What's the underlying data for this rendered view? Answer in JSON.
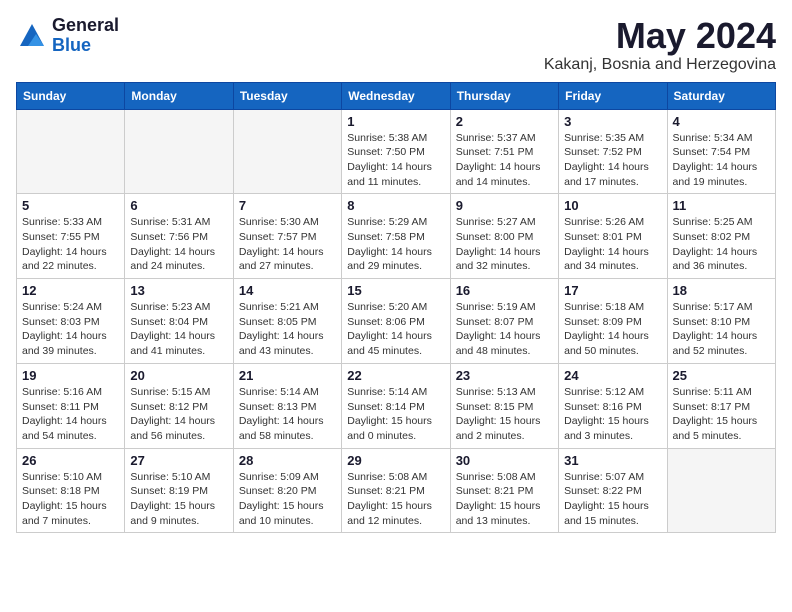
{
  "header": {
    "logo_general": "General",
    "logo_blue": "Blue",
    "month_title": "May 2024",
    "location": "Kakanj, Bosnia and Herzegovina"
  },
  "weekdays": [
    "Sunday",
    "Monday",
    "Tuesday",
    "Wednesday",
    "Thursday",
    "Friday",
    "Saturday"
  ],
  "weeks": [
    [
      {
        "day": "",
        "info": ""
      },
      {
        "day": "",
        "info": ""
      },
      {
        "day": "",
        "info": ""
      },
      {
        "day": "1",
        "info": "Sunrise: 5:38 AM\nSunset: 7:50 PM\nDaylight: 14 hours and 11 minutes."
      },
      {
        "day": "2",
        "info": "Sunrise: 5:37 AM\nSunset: 7:51 PM\nDaylight: 14 hours and 14 minutes."
      },
      {
        "day": "3",
        "info": "Sunrise: 5:35 AM\nSunset: 7:52 PM\nDaylight: 14 hours and 17 minutes."
      },
      {
        "day": "4",
        "info": "Sunrise: 5:34 AM\nSunset: 7:54 PM\nDaylight: 14 hours and 19 minutes."
      }
    ],
    [
      {
        "day": "5",
        "info": "Sunrise: 5:33 AM\nSunset: 7:55 PM\nDaylight: 14 hours and 22 minutes."
      },
      {
        "day": "6",
        "info": "Sunrise: 5:31 AM\nSunset: 7:56 PM\nDaylight: 14 hours and 24 minutes."
      },
      {
        "day": "7",
        "info": "Sunrise: 5:30 AM\nSunset: 7:57 PM\nDaylight: 14 hours and 27 minutes."
      },
      {
        "day": "8",
        "info": "Sunrise: 5:29 AM\nSunset: 7:58 PM\nDaylight: 14 hours and 29 minutes."
      },
      {
        "day": "9",
        "info": "Sunrise: 5:27 AM\nSunset: 8:00 PM\nDaylight: 14 hours and 32 minutes."
      },
      {
        "day": "10",
        "info": "Sunrise: 5:26 AM\nSunset: 8:01 PM\nDaylight: 14 hours and 34 minutes."
      },
      {
        "day": "11",
        "info": "Sunrise: 5:25 AM\nSunset: 8:02 PM\nDaylight: 14 hours and 36 minutes."
      }
    ],
    [
      {
        "day": "12",
        "info": "Sunrise: 5:24 AM\nSunset: 8:03 PM\nDaylight: 14 hours and 39 minutes."
      },
      {
        "day": "13",
        "info": "Sunrise: 5:23 AM\nSunset: 8:04 PM\nDaylight: 14 hours and 41 minutes."
      },
      {
        "day": "14",
        "info": "Sunrise: 5:21 AM\nSunset: 8:05 PM\nDaylight: 14 hours and 43 minutes."
      },
      {
        "day": "15",
        "info": "Sunrise: 5:20 AM\nSunset: 8:06 PM\nDaylight: 14 hours and 45 minutes."
      },
      {
        "day": "16",
        "info": "Sunrise: 5:19 AM\nSunset: 8:07 PM\nDaylight: 14 hours and 48 minutes."
      },
      {
        "day": "17",
        "info": "Sunrise: 5:18 AM\nSunset: 8:09 PM\nDaylight: 14 hours and 50 minutes."
      },
      {
        "day": "18",
        "info": "Sunrise: 5:17 AM\nSunset: 8:10 PM\nDaylight: 14 hours and 52 minutes."
      }
    ],
    [
      {
        "day": "19",
        "info": "Sunrise: 5:16 AM\nSunset: 8:11 PM\nDaylight: 14 hours and 54 minutes."
      },
      {
        "day": "20",
        "info": "Sunrise: 5:15 AM\nSunset: 8:12 PM\nDaylight: 14 hours and 56 minutes."
      },
      {
        "day": "21",
        "info": "Sunrise: 5:14 AM\nSunset: 8:13 PM\nDaylight: 14 hours and 58 minutes."
      },
      {
        "day": "22",
        "info": "Sunrise: 5:14 AM\nSunset: 8:14 PM\nDaylight: 15 hours and 0 minutes."
      },
      {
        "day": "23",
        "info": "Sunrise: 5:13 AM\nSunset: 8:15 PM\nDaylight: 15 hours and 2 minutes."
      },
      {
        "day": "24",
        "info": "Sunrise: 5:12 AM\nSunset: 8:16 PM\nDaylight: 15 hours and 3 minutes."
      },
      {
        "day": "25",
        "info": "Sunrise: 5:11 AM\nSunset: 8:17 PM\nDaylight: 15 hours and 5 minutes."
      }
    ],
    [
      {
        "day": "26",
        "info": "Sunrise: 5:10 AM\nSunset: 8:18 PM\nDaylight: 15 hours and 7 minutes."
      },
      {
        "day": "27",
        "info": "Sunrise: 5:10 AM\nSunset: 8:19 PM\nDaylight: 15 hours and 9 minutes."
      },
      {
        "day": "28",
        "info": "Sunrise: 5:09 AM\nSunset: 8:20 PM\nDaylight: 15 hours and 10 minutes."
      },
      {
        "day": "29",
        "info": "Sunrise: 5:08 AM\nSunset: 8:21 PM\nDaylight: 15 hours and 12 minutes."
      },
      {
        "day": "30",
        "info": "Sunrise: 5:08 AM\nSunset: 8:21 PM\nDaylight: 15 hours and 13 minutes."
      },
      {
        "day": "31",
        "info": "Sunrise: 5:07 AM\nSunset: 8:22 PM\nDaylight: 15 hours and 15 minutes."
      },
      {
        "day": "",
        "info": ""
      }
    ]
  ]
}
